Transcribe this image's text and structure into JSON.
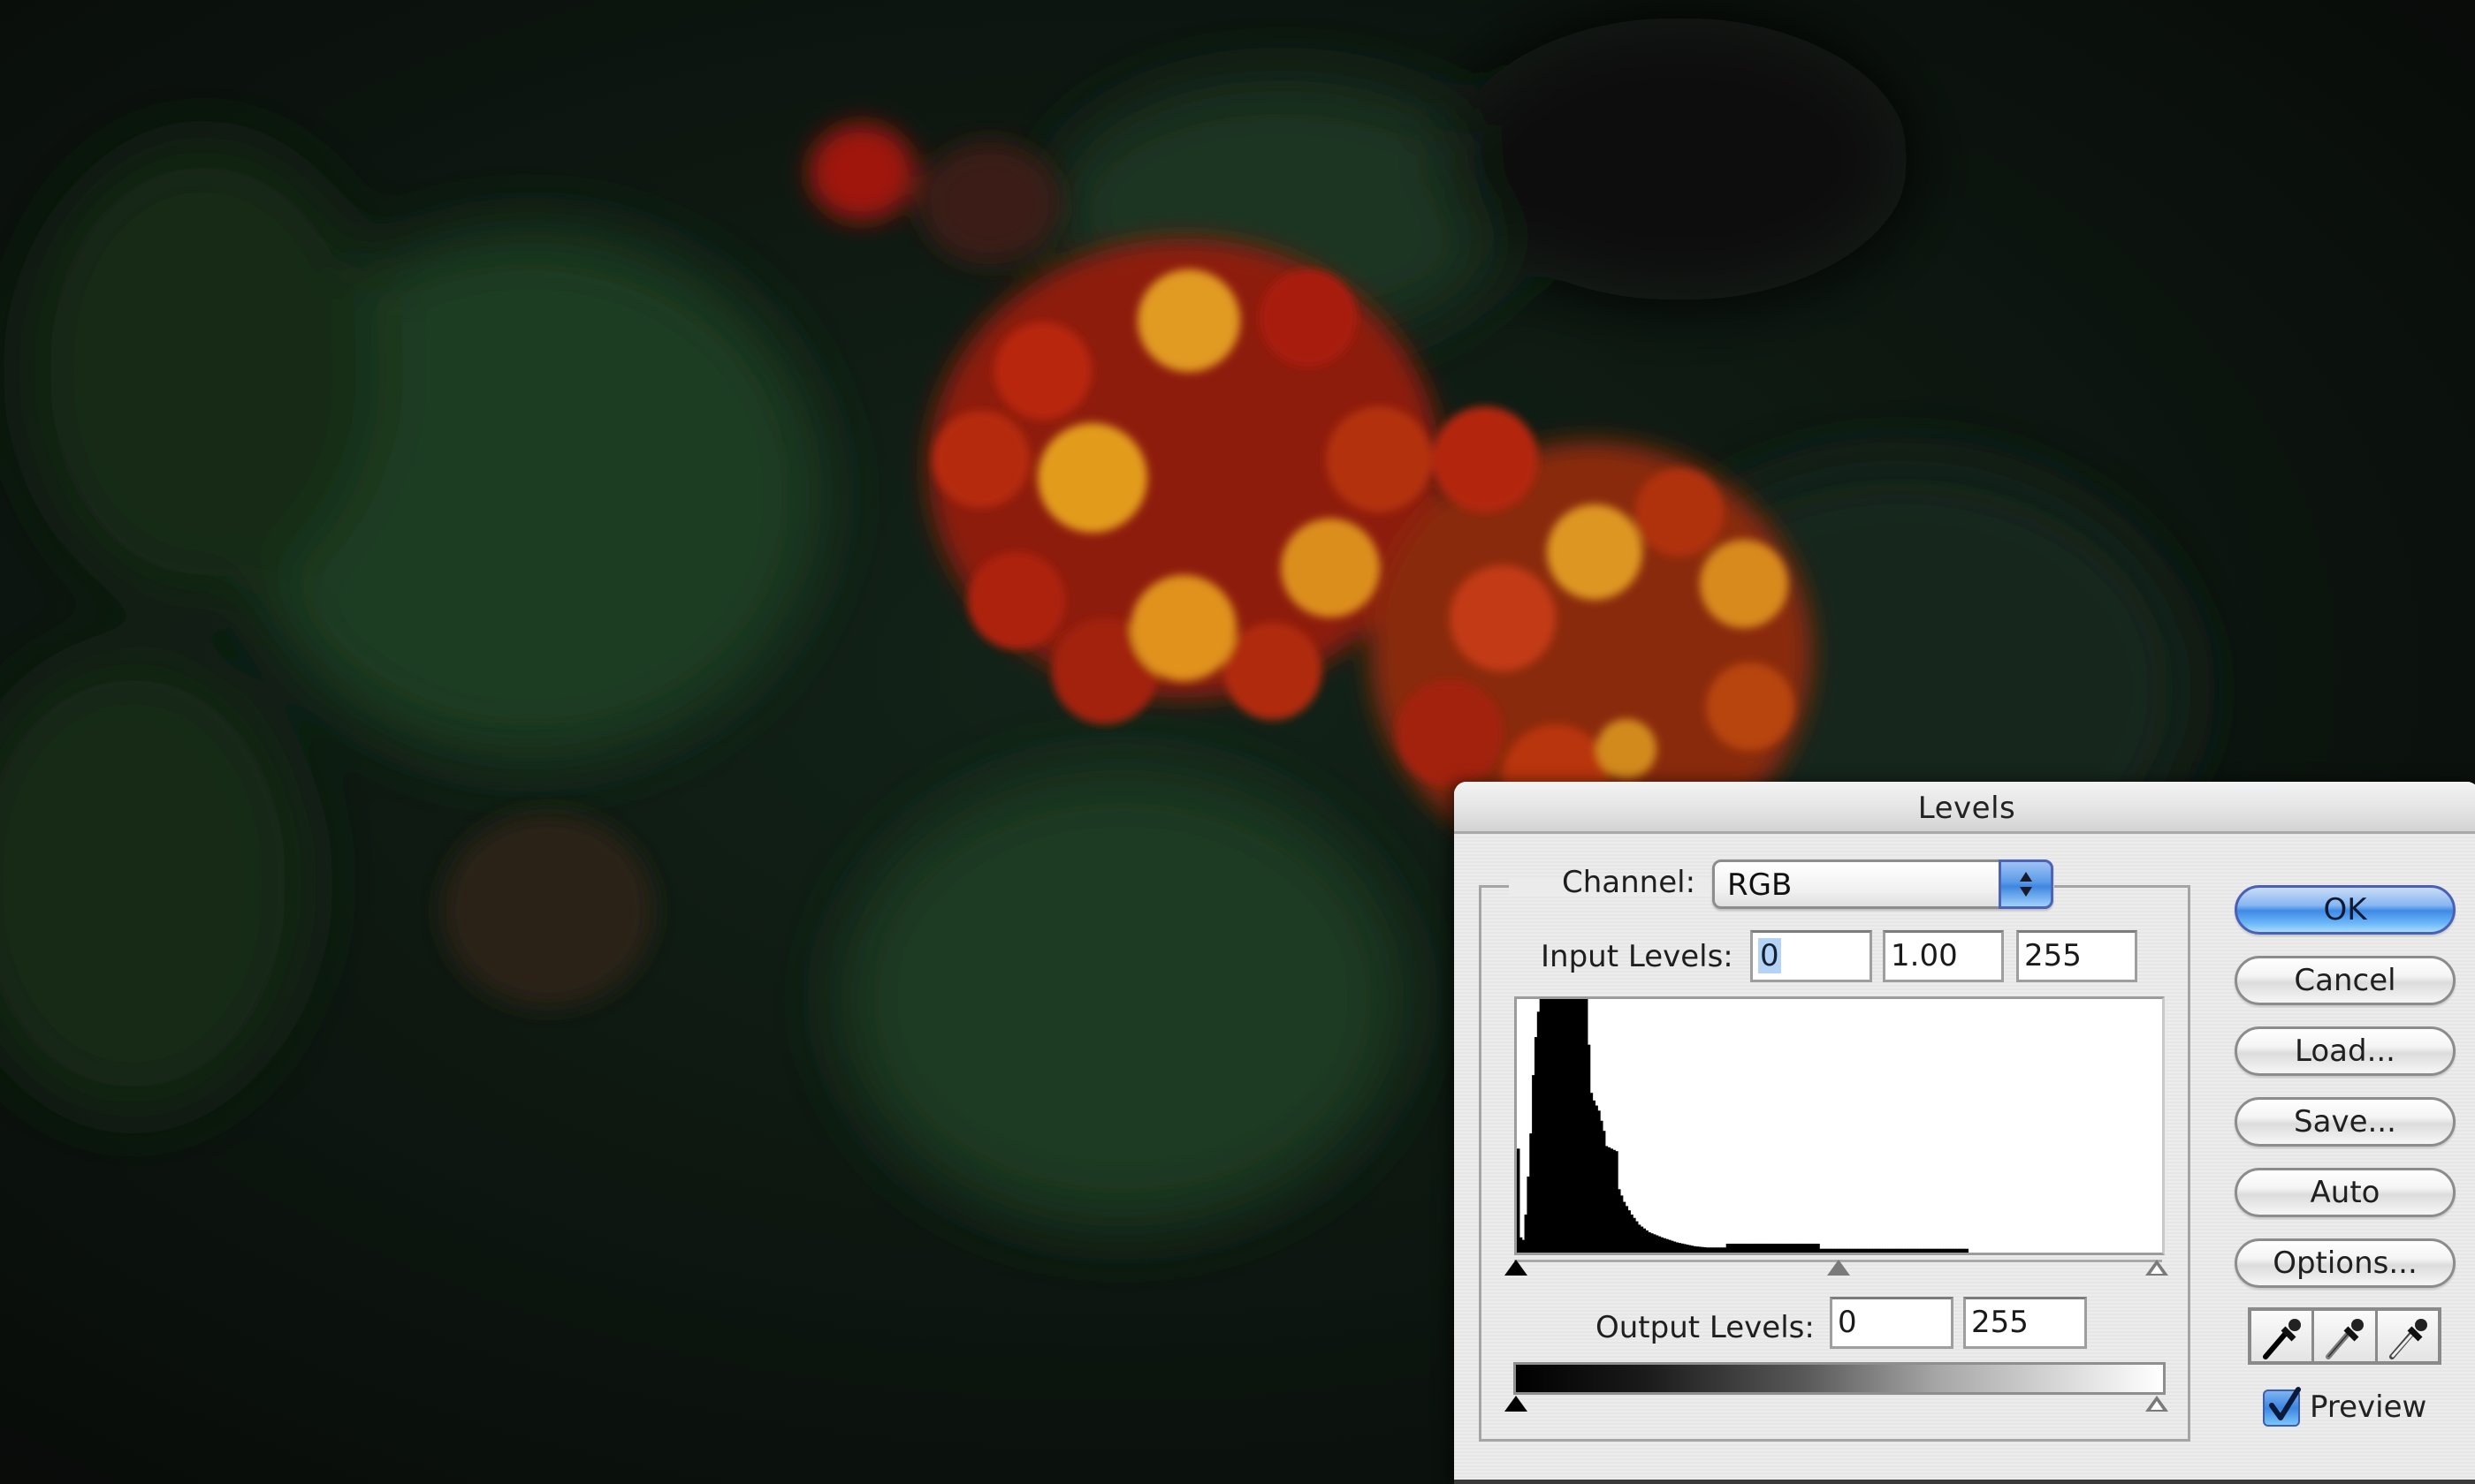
{
  "background": {
    "description": "dark photograph of red and orange lantana flowers with green leaves",
    "colors": {
      "base": "#0c0e0b",
      "leaf": "#1e3a22",
      "floret_red": "#b3250e",
      "floret_orange": "#c8441a",
      "floret_yellow": "#e0981e"
    }
  },
  "dialog": {
    "title": "Levels",
    "channel": {
      "label": "Channel:",
      "value": "RGB"
    },
    "input_levels": {
      "label": "Input Levels:",
      "black": "0",
      "gamma": "1.00",
      "white": "255"
    },
    "output_levels": {
      "label": "Output Levels:",
      "black": "0",
      "white": "255"
    },
    "buttons": {
      "ok": "OK",
      "cancel": "Cancel",
      "load": "Load...",
      "save": "Save...",
      "auto": "Auto",
      "options": "Options..."
    },
    "eyedroppers": [
      "black-point-eyedropper",
      "gray-point-eyedropper",
      "white-point-eyedropper"
    ],
    "preview": {
      "label": "Preview",
      "checked": true
    },
    "colors": {
      "accent": "#3f8ae6",
      "panel": "#ececec",
      "selection": "#b5d3f7"
    },
    "sliders": {
      "input_black": 0,
      "input_gamma": 1.0,
      "input_white": 255,
      "output_black": 0,
      "output_white": 255
    }
  },
  "chart_data": {
    "type": "area",
    "title": "RGB histogram",
    "xlabel": "",
    "ylabel": "",
    "xlim": [
      0,
      255
    ],
    "ylim": [
      0,
      1
    ],
    "x": [
      0,
      1,
      2,
      3,
      4,
      5,
      6,
      7,
      8,
      9,
      27,
      28,
      29,
      30,
      32,
      34,
      35,
      37,
      39,
      40,
      42,
      45,
      48,
      52,
      57,
      63,
      70,
      75,
      80,
      82,
      83,
      119,
      120,
      178,
      179,
      255
    ],
    "values": [
      0.41,
      0.06,
      0.05,
      0.15,
      0.3,
      0.47,
      0.7,
      0.85,
      0.95,
      1.0,
      1.0,
      0.82,
      0.63,
      0.6,
      0.56,
      0.48,
      0.42,
      0.41,
      0.4,
      0.25,
      0.2,
      0.15,
      0.11,
      0.08,
      0.06,
      0.04,
      0.025,
      0.02,
      0.02,
      0.02,
      0.035,
      0.035,
      0.015,
      0.015,
      0,
      0
    ],
    "grid": false,
    "legend": "none"
  }
}
